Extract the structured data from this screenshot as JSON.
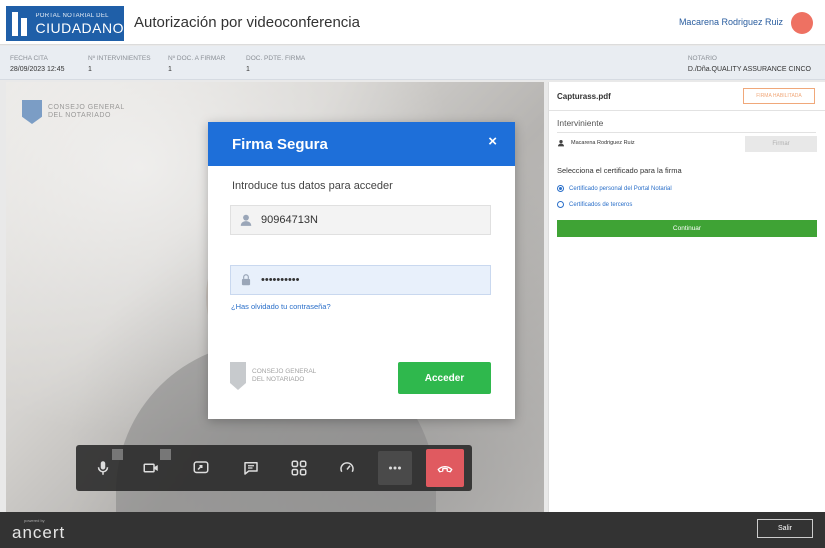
{
  "header": {
    "logo_line1": "PORTAL NOTARIAL DEL",
    "logo_line2": "CIUDADANO",
    "title": "Autorización por videoconferencia",
    "user_name": "Macarena Rodriguez Ruiz",
    "avatar_color": "#ee7162"
  },
  "infobar": {
    "fecha_cita_label": "FECHA CITA",
    "fecha_cita_value": "28/09/2023 12:45",
    "intervinientes_label": "Nº INTERVINIENTES",
    "intervinientes_value": "1",
    "doc_firmar_label": "Nº DOC. A FIRMAR",
    "doc_firmar_value": "1",
    "doc_pdte_label": "DOC. PDTE. FIRMA",
    "doc_pdte_value": "1",
    "notario_label": "NOTARIO",
    "notario_value": "D./Dña.QUALITY ASSURANCE CINCO"
  },
  "video": {
    "logo_text_1": "CONSEJO GENERAL",
    "logo_text_2": "DEL NOTARIADO"
  },
  "toolbar": {
    "buttons": [
      "microphone-icon",
      "camera-icon",
      "share-screen-icon",
      "chat-icon",
      "apps-grid-icon",
      "speed-gauge-icon",
      "more-icon",
      "hang-up-icon"
    ]
  },
  "panel": {
    "doc_name": "Capturass.pdf",
    "firma_status": "FIRMA HABILITADA",
    "interviniente_title": "Interviniente",
    "interviniente_name": "Macarena Rodriguez Ruiz",
    "firmar_label": "Firmar",
    "cert_title": "Selecciona el certificado para la firma",
    "cert_option_1": "Certificado personal del Portal Notarial",
    "cert_option_2": "Certificados de terceros",
    "continuar_label": "Continuar"
  },
  "footer": {
    "powered_by": "powered by",
    "brand": "ancert",
    "salir_label": "Salir"
  },
  "modal": {
    "title": "Firma Segura",
    "close": "×",
    "subtitle": "Introduce tus datos para acceder",
    "username_value": "90964713N",
    "password_value": "••••••••••",
    "forgot_label": "¿Has olvidado tu contraseña?",
    "cgn_line1": "CONSEJO GENERAL",
    "cgn_line2": "DEL NOTARIADO",
    "acceder_label": "Acceder"
  },
  "colors": {
    "brand_blue": "#1f5fa8",
    "modal_blue": "#1e6fd9",
    "green": "#2fb84d",
    "hangup_red": "#e05a60"
  }
}
